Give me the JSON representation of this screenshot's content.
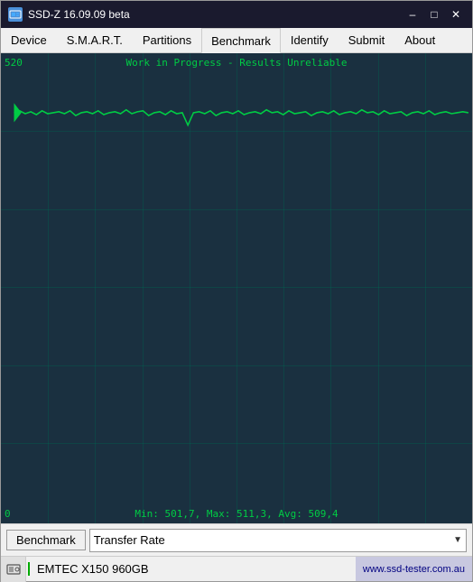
{
  "window": {
    "title": "SSD-Z 16.09.09 beta",
    "icon": "SSD"
  },
  "titleControls": {
    "minimize": "–",
    "maximize": "□",
    "close": "✕"
  },
  "menuBar": {
    "items": [
      {
        "label": "Device",
        "active": false
      },
      {
        "label": "S.M.A.R.T.",
        "active": false
      },
      {
        "label": "Partitions",
        "active": false
      },
      {
        "label": "Benchmark",
        "active": true
      },
      {
        "label": "Identify",
        "active": false
      },
      {
        "label": "Submit",
        "active": false
      },
      {
        "label": "About",
        "active": false
      }
    ]
  },
  "chart": {
    "topLabel": "520",
    "title": "Work in Progress - Results Unreliable",
    "bottomLabel": "0",
    "stats": "Min: 501,7, Max: 511,3, Avg: 509,4",
    "lineColor": "#00cc44",
    "bgColor": "#1a3040"
  },
  "bottomBar": {
    "benchmarkLabel": "Benchmark",
    "dropdownValue": "Transfer Rate",
    "dropdownArrow": "▼"
  },
  "statusBar": {
    "deviceLabel": "EMTEC X150 960GB",
    "url": "www.ssd-tester.com.au"
  }
}
